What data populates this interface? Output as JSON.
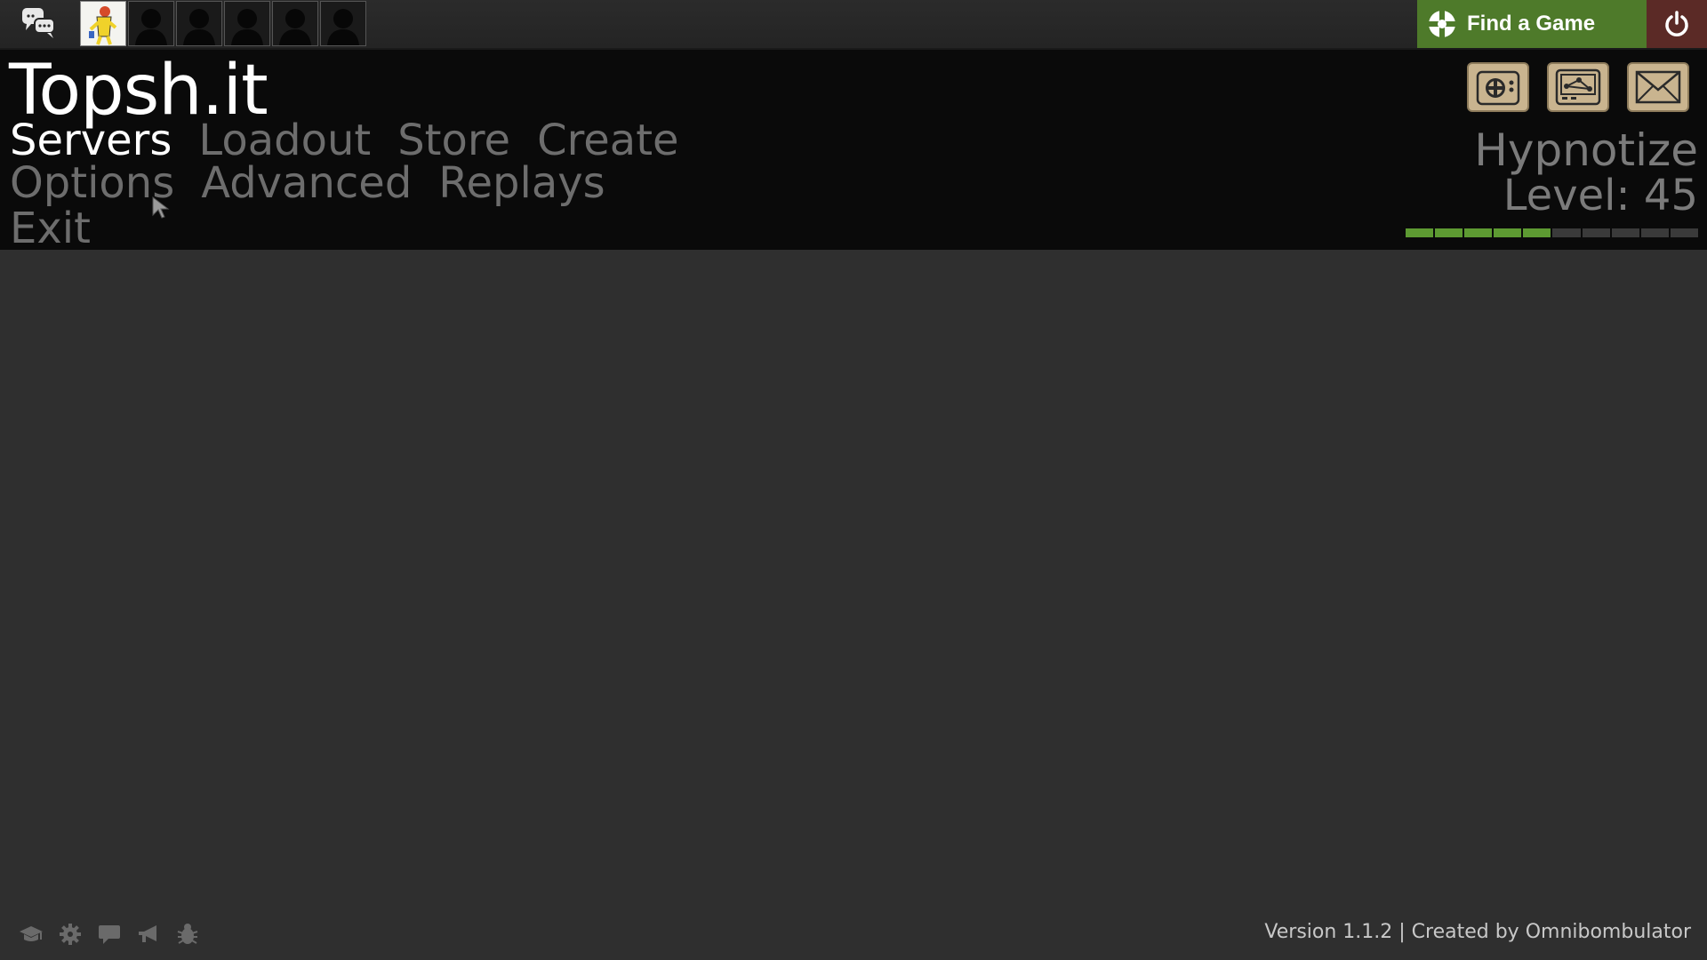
{
  "topbar": {
    "find_game_label": "Find a Game",
    "party_slots": [
      "filled",
      "empty",
      "empty",
      "empty",
      "empty",
      "empty"
    ],
    "icons": {
      "chat": "chat-bubbles-icon",
      "find_game": "team-logo-icon",
      "power": "power-icon"
    }
  },
  "header": {
    "title": "Topsh.it",
    "menu": {
      "row1": [
        "Servers",
        "Loadout",
        "Store",
        "Create"
      ],
      "row2": [
        "Options",
        "Advanced",
        "Replays"
      ],
      "row3": [
        "Exit"
      ]
    },
    "active_item": "Servers",
    "right_icons": [
      "tv-icon",
      "network-icon",
      "mail-icon"
    ],
    "player": {
      "name": "Hypnotize",
      "level_text": "Level: 45",
      "xp_progress": 0.51
    }
  },
  "footer": {
    "icons": [
      "graduation-cap-icon",
      "gear-icon",
      "speech-bubble-icon",
      "megaphone-icon",
      "bug-icon"
    ],
    "version_text": "Version 1.1.2 | Created by Omnibombulator"
  },
  "colors": {
    "background": "#2f2f2f",
    "header_bg": "#0a0a0a",
    "find_game_bg": "#4e7a2a",
    "power_bg": "#5b2a26",
    "xp_green": "#5d9a32",
    "menu_inactive": "#6d6d6d",
    "menu_active": "#ffffff"
  }
}
